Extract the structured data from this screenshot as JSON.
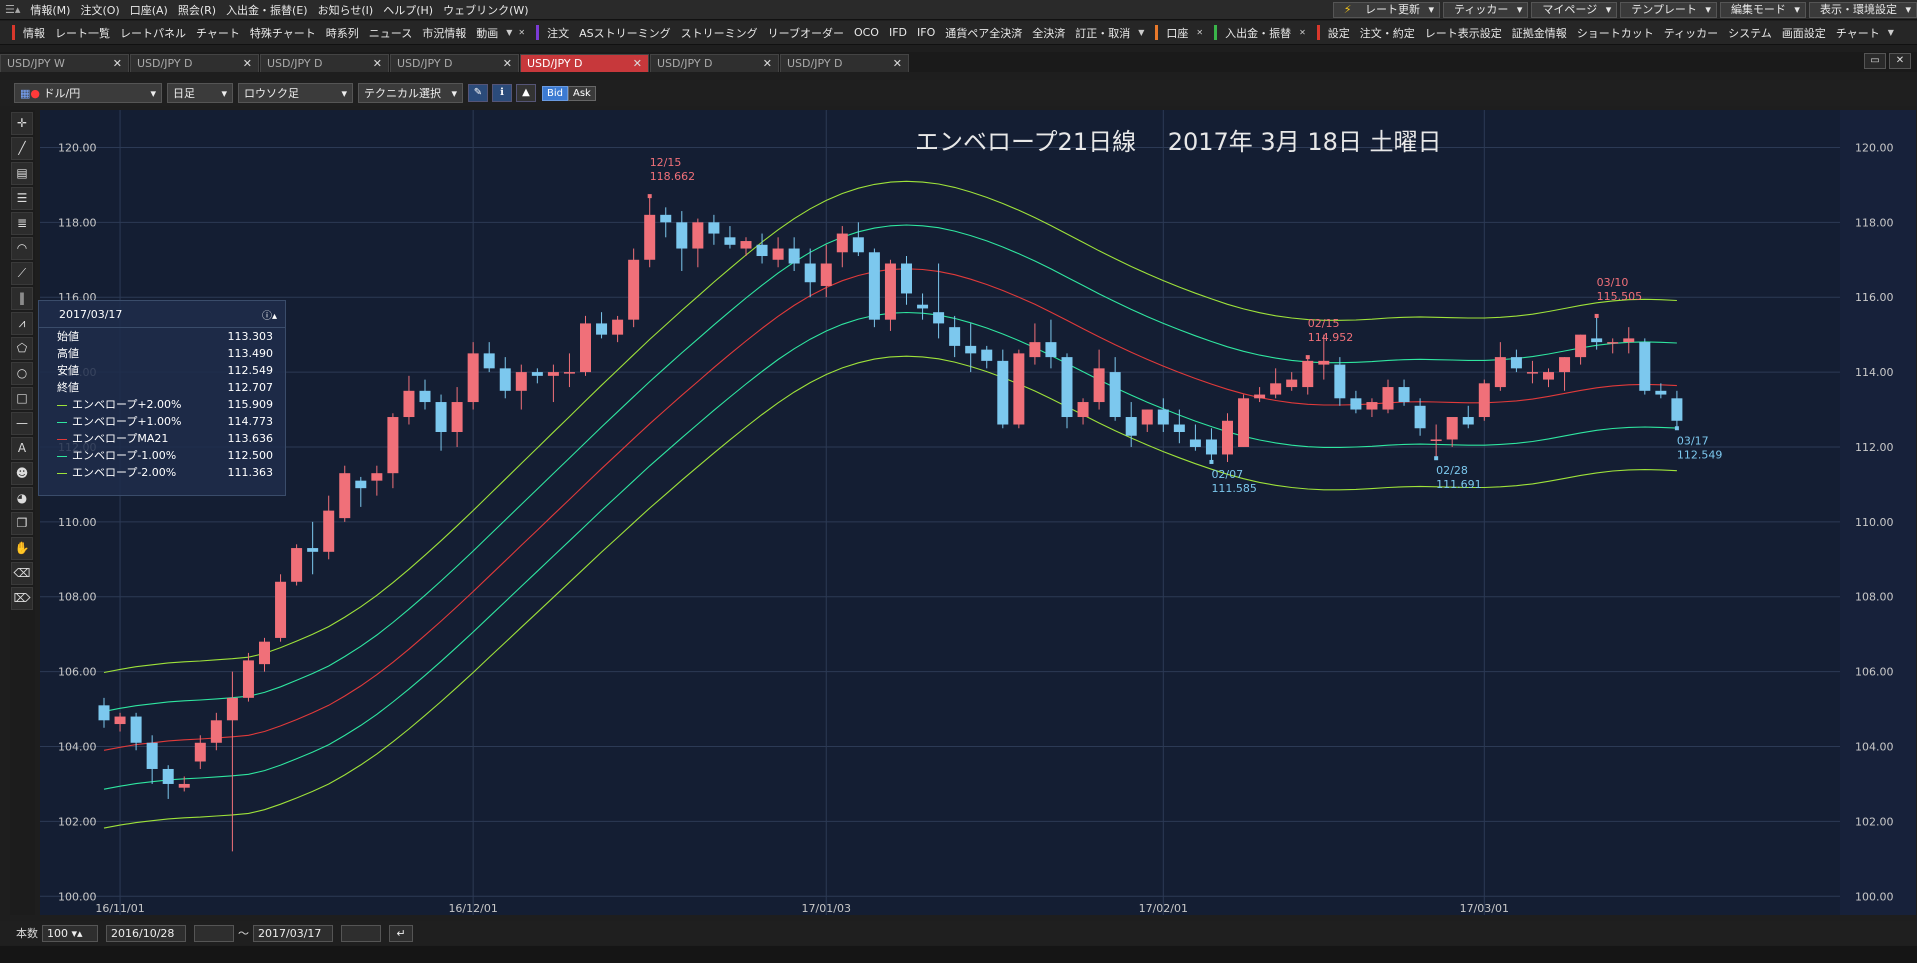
{
  "menu": [
    "情報(M)",
    "注文(O)",
    "口座(A)",
    "照会(R)",
    "入出金・振替(E)",
    "お知らせ(I)",
    "ヘルプ(H)",
    "ウェブリンク(W)"
  ],
  "right_buttons": [
    "レート更新",
    "ティッカー",
    "マイページ",
    "テンプレート",
    "編集モード",
    "表示・環境設定"
  ],
  "toolbar": {
    "info_label": "情報",
    "info_items": [
      "レート一覧",
      "レートパネル",
      "チャート",
      "特殊チャート",
      "時系列",
      "ニュース",
      "市況情報",
      "動画"
    ],
    "order_label": "注文",
    "order_items": [
      "ASストリーミング",
      "ストリーミング",
      "リーブオーダー",
      "OCO",
      "IFD",
      "IFO",
      "通貨ペア全決済",
      "全決済",
      "訂正・取消"
    ],
    "account_label": "口座",
    "deposit_label": "入出金・振替",
    "settings_label": "設定",
    "settings_items": [
      "注文・約定",
      "レート表示設定",
      "証拠金情報",
      "ショートカット",
      "ティッカー",
      "システム",
      "画面設定",
      "チャート"
    ]
  },
  "tabs": [
    {
      "label": "USD/JPY W",
      "active": false
    },
    {
      "label": "USD/JPY D",
      "active": false
    },
    {
      "label": "USD/JPY D",
      "active": false
    },
    {
      "label": "USD/JPY D",
      "active": false
    },
    {
      "label": "USD/JPY D",
      "active": true
    },
    {
      "label": "USD/JPY D",
      "active": false
    },
    {
      "label": "USD/JPY D",
      "active": false
    }
  ],
  "controls": {
    "pair": "ドル/円",
    "period": "日足",
    "chart_style": "ロウソク足",
    "technical": "テクニカル選択",
    "bid": "Bid",
    "ask": "Ask"
  },
  "bottom": {
    "count_label": "本数",
    "count": "100",
    "from_date": "2016/10/28",
    "tilde": "～",
    "to_date": "2017/03/17"
  },
  "infobox": {
    "date": "2017/03/17",
    "rows": [
      {
        "label": "始値",
        "value": "113.303"
      },
      {
        "label": "高値",
        "value": "113.490"
      },
      {
        "label": "安値",
        "value": "112.549"
      },
      {
        "label": "終値",
        "value": "112.707"
      }
    ],
    "env_rows": [
      {
        "label": "エンベロープ+2.00%",
        "value": "115.909",
        "color": "#9ee23a"
      },
      {
        "label": "エンベロープ+1.00%",
        "value": "114.773",
        "color": "#2fe6a0"
      },
      {
        "label": "エンベロープMA21",
        "value": "113.636",
        "color": "#e03a3a"
      },
      {
        "label": "エンベロープ-1.00%",
        "value": "112.500",
        "color": "#2fe6a0"
      },
      {
        "label": "エンベロープ-2.00%",
        "value": "111.363",
        "color": "#9ee23a"
      }
    ]
  },
  "chart_data": {
    "type": "candlestick",
    "title": "エンベロープ21日線　 2017年 3月 18日 土曜日",
    "ylim": [
      99.5,
      121.0
    ],
    "yticks": [
      "120.00",
      "118.00",
      "116.00",
      "114.00",
      "112.00",
      "110.00",
      "108.00",
      "106.00",
      "104.00",
      "102.00",
      "100.00"
    ],
    "xticks": [
      {
        "label": "16/11/01",
        "index": 1
      },
      {
        "label": "16/12/01",
        "index": 23
      },
      {
        "label": "17/01/03",
        "index": 45
      },
      {
        "label": "17/02/01",
        "index": 66
      },
      {
        "label": "17/03/01",
        "index": 86
      }
    ],
    "grid": true,
    "candles": [
      [
        105.1,
        105.3,
        104.5,
        104.7
      ],
      [
        104.6,
        104.9,
        104.4,
        104.8
      ],
      [
        104.8,
        104.9,
        103.9,
        104.1
      ],
      [
        104.1,
        104.3,
        103.0,
        103.4
      ],
      [
        103.4,
        103.5,
        102.6,
        103.0
      ],
      [
        102.9,
        103.2,
        102.8,
        103.0
      ],
      [
        103.6,
        104.3,
        103.4,
        104.1
      ],
      [
        104.1,
        104.9,
        103.9,
        104.7
      ],
      [
        104.7,
        106.0,
        101.2,
        105.3
      ],
      [
        105.3,
        106.5,
        105.2,
        106.3
      ],
      [
        106.2,
        106.9,
        106.0,
        106.8
      ],
      [
        106.9,
        108.6,
        106.8,
        108.4
      ],
      [
        108.4,
        109.4,
        108.3,
        109.3
      ],
      [
        109.3,
        110.0,
        108.6,
        109.2
      ],
      [
        109.2,
        110.7,
        109.0,
        110.3
      ],
      [
        110.1,
        111.5,
        110.0,
        111.3
      ],
      [
        111.1,
        111.2,
        110.4,
        110.9
      ],
      [
        111.1,
        111.5,
        110.7,
        111.3
      ],
      [
        111.3,
        112.9,
        110.9,
        112.8
      ],
      [
        112.8,
        113.9,
        112.6,
        113.5
      ],
      [
        113.5,
        113.8,
        113.0,
        113.2
      ],
      [
        113.2,
        113.4,
        111.9,
        112.4
      ],
      [
        112.4,
        113.6,
        112.0,
        113.2
      ],
      [
        113.2,
        114.8,
        113.0,
        114.5
      ],
      [
        114.5,
        114.8,
        114.0,
        114.1
      ],
      [
        114.1,
        114.4,
        113.3,
        113.5
      ],
      [
        113.5,
        114.2,
        113.0,
        114.0
      ],
      [
        114.0,
        114.1,
        113.7,
        113.9
      ],
      [
        113.9,
        114.2,
        113.2,
        114.0
      ],
      [
        114.0,
        114.5,
        113.6,
        114.0
      ],
      [
        114.0,
        115.5,
        113.9,
        115.3
      ],
      [
        115.3,
        115.6,
        114.9,
        115.0
      ],
      [
        115.0,
        115.5,
        114.8,
        115.4
      ],
      [
        115.4,
        117.3,
        115.2,
        117.0
      ],
      [
        117.0,
        118.7,
        116.8,
        118.2
      ],
      [
        118.2,
        118.4,
        117.6,
        118.0
      ],
      [
        118.0,
        118.3,
        116.7,
        117.3
      ],
      [
        117.3,
        118.1,
        116.8,
        118.0
      ],
      [
        118.0,
        118.2,
        117.4,
        117.7
      ],
      [
        117.6,
        117.9,
        117.3,
        117.4
      ],
      [
        117.3,
        117.6,
        117.1,
        117.5
      ],
      [
        117.4,
        117.7,
        116.9,
        117.1
      ],
      [
        117.0,
        117.6,
        116.8,
        117.3
      ],
      [
        117.3,
        117.6,
        116.7,
        116.9
      ],
      [
        116.9,
        117.3,
        116.0,
        116.4
      ],
      [
        116.3,
        117.4,
        116.0,
        116.9
      ],
      [
        117.2,
        117.9,
        116.8,
        117.7
      ],
      [
        117.6,
        118.0,
        117.1,
        117.2
      ],
      [
        117.2,
        117.3,
        115.2,
        115.4
      ],
      [
        115.4,
        117.0,
        115.1,
        116.9
      ],
      [
        116.9,
        117.1,
        115.8,
        116.1
      ],
      [
        115.8,
        116.1,
        115.4,
        115.7
      ],
      [
        115.6,
        116.9,
        114.9,
        115.3
      ],
      [
        115.2,
        115.5,
        114.4,
        114.7
      ],
      [
        114.7,
        115.3,
        114.0,
        114.5
      ],
      [
        114.6,
        114.7,
        114.1,
        114.3
      ],
      [
        114.3,
        114.6,
        112.5,
        112.6
      ],
      [
        112.6,
        114.6,
        112.5,
        114.5
      ],
      [
        114.4,
        115.3,
        114.2,
        114.8
      ],
      [
        114.8,
        115.4,
        114.1,
        114.4
      ],
      [
        114.4,
        114.5,
        112.5,
        112.8
      ],
      [
        112.8,
        113.3,
        112.6,
        113.2
      ],
      [
        113.2,
        114.6,
        113.0,
        114.1
      ],
      [
        114.0,
        114.4,
        112.7,
        112.8
      ],
      [
        112.8,
        113.2,
        112.0,
        112.3
      ],
      [
        112.6,
        113.0,
        112.4,
        113.0
      ],
      [
        113.0,
        113.3,
        112.4,
        112.6
      ],
      [
        112.6,
        113.0,
        112.1,
        112.4
      ],
      [
        112.2,
        112.6,
        111.9,
        112.0
      ],
      [
        112.2,
        112.5,
        111.6,
        111.8
      ],
      [
        111.8,
        112.9,
        111.6,
        112.7
      ],
      [
        112.0,
        113.4,
        112.0,
        113.3
      ],
      [
        113.3,
        113.6,
        113.2,
        113.4
      ],
      [
        113.4,
        114.1,
        113.3,
        113.7
      ],
      [
        113.6,
        114.0,
        113.5,
        113.8
      ],
      [
        113.6,
        114.4,
        113.4,
        114.3
      ],
      [
        114.2,
        115.0,
        113.8,
        114.3
      ],
      [
        114.2,
        114.4,
        113.1,
        113.3
      ],
      [
        113.3,
        113.5,
        112.9,
        113.0
      ],
      [
        113.0,
        113.3,
        112.8,
        113.2
      ],
      [
        113.0,
        113.8,
        112.9,
        113.6
      ],
      [
        113.6,
        113.8,
        113.1,
        113.2
      ],
      [
        113.1,
        113.3,
        112.3,
        112.5
      ],
      [
        112.2,
        112.6,
        111.7,
        112.2
      ],
      [
        112.2,
        112.7,
        112.0,
        112.8
      ],
      [
        112.8,
        113.1,
        112.5,
        112.6
      ],
      [
        112.8,
        113.8,
        112.7,
        113.7
      ],
      [
        113.6,
        114.8,
        113.5,
        114.4
      ],
      [
        114.4,
        114.6,
        114.0,
        114.1
      ],
      [
        114.0,
        114.3,
        113.7,
        114.0
      ],
      [
        113.8,
        114.1,
        113.6,
        114.0
      ],
      [
        114.0,
        114.4,
        113.5,
        114.4
      ],
      [
        114.4,
        115.0,
        114.2,
        115.0
      ],
      [
        114.9,
        115.5,
        114.6,
        114.8
      ],
      [
        114.8,
        114.9,
        114.5,
        114.8
      ],
      [
        114.8,
        115.2,
        114.5,
        114.9
      ],
      [
        114.8,
        114.9,
        113.4,
        113.5
      ],
      [
        113.5,
        113.7,
        113.3,
        113.4
      ],
      [
        113.3,
        113.5,
        112.5,
        112.7
      ]
    ],
    "envelope": {
      "start_index": 0,
      "ma21": [
        103.9,
        103.98,
        104.05,
        104.1,
        104.15,
        104.18,
        104.2,
        104.23,
        104.26,
        104.3,
        104.4,
        104.55,
        104.72,
        104.9,
        105.1,
        105.35,
        105.62,
        105.92,
        106.25,
        106.6,
        106.97,
        107.35,
        107.74,
        108.14,
        108.55,
        108.96,
        109.37,
        109.78,
        110.19,
        110.6,
        111.01,
        111.42,
        111.82,
        112.22,
        112.62,
        113.0,
        113.38,
        113.75,
        114.12,
        114.48,
        114.83,
        115.17,
        115.49,
        115.78,
        116.04,
        116.26,
        116.44,
        116.58,
        116.68,
        116.74,
        116.76,
        116.74,
        116.69,
        116.6,
        116.48,
        116.34,
        116.18,
        116.0,
        115.81,
        115.6,
        115.38,
        115.16,
        114.94,
        114.73,
        114.53,
        114.34,
        114.16,
        113.99,
        113.83,
        113.68,
        113.54,
        113.42,
        113.32,
        113.24,
        113.18,
        113.14,
        113.12,
        113.12,
        113.13,
        113.15,
        113.18,
        113.2,
        113.21,
        113.2,
        113.19,
        113.18,
        113.18,
        113.2,
        113.23,
        113.28,
        113.35,
        113.43,
        113.51,
        113.58,
        113.63,
        113.66,
        113.67,
        113.66,
        113.64
      ]
    },
    "annotations": [
      {
        "date": "12/15",
        "value": "118.662",
        "index": 34,
        "kind": "high"
      },
      {
        "date": "02/07",
        "value": "111.585",
        "index": 69,
        "kind": "low"
      },
      {
        "date": "02/15",
        "value": "114.952",
        "index": 75,
        "kind": "high"
      },
      {
        "date": "02/28",
        "value": "111.691",
        "index": 83,
        "kind": "low"
      },
      {
        "date": "03/10",
        "value": "115.505",
        "index": 93,
        "kind": "high"
      },
      {
        "date": "03/17",
        "value": "112.549",
        "index": 98,
        "kind": "low"
      }
    ],
    "colors": {
      "up": "#f07079",
      "down": "#7cc8ee",
      "ma": "#e03a3a",
      "env1": "#2fe6a0",
      "env2": "#9ee23a",
      "bg": "#141e33",
      "grid": "#2c3a55",
      "text": "#c8c8c8"
    }
  }
}
